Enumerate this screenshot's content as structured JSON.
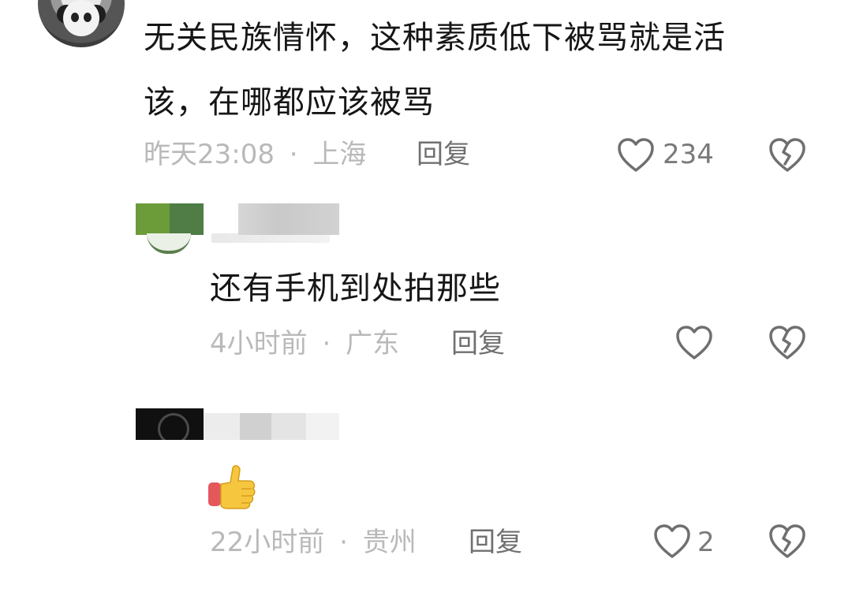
{
  "comments": [
    {
      "text_line1": "无关民族情怀，这种素质低下被骂就是活",
      "text_line2": "该，在哪都应该被骂",
      "time": "昨天23:08",
      "separator": "·",
      "location": "上海",
      "reply_label": "回复",
      "like_count": "234",
      "like_icon": "heart-outline-icon",
      "dislike_icon": "broken-heart-icon"
    },
    {
      "text": "还有手机到处拍那些",
      "time": "4小时前",
      "separator": "·",
      "location": "广东",
      "reply_label": "回复",
      "like_icon": "heart-outline-icon",
      "dislike_icon": "broken-heart-icon"
    },
    {
      "emoji": "👍",
      "time": "22小时前",
      "separator": "·",
      "location": "贵州",
      "reply_label": "回复",
      "like_count": "2",
      "like_icon": "heart-outline-icon",
      "dislike_icon": "broken-heart-icon"
    }
  ],
  "colors": {
    "text": "#161616",
    "meta": "#b9b9b9",
    "reply": "#707070",
    "icon": "#6f6f6f"
  }
}
